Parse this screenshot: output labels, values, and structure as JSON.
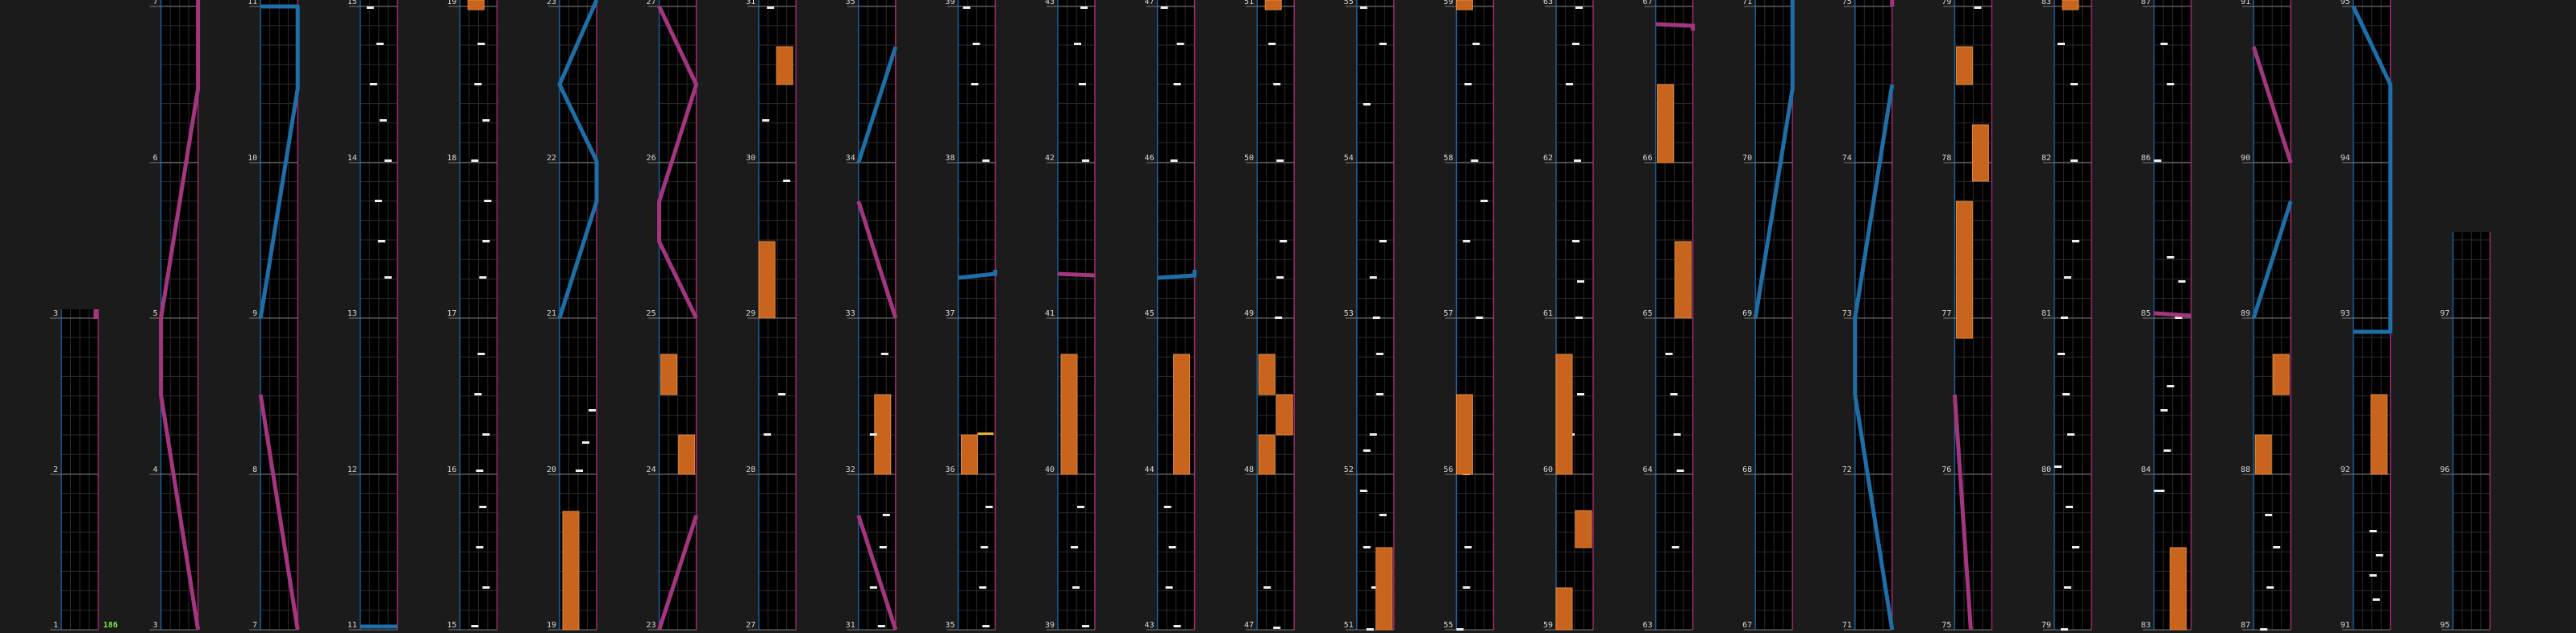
{
  "app": {
    "name": "chart-editor-timeline"
  },
  "colors": {
    "background": "#1b1b1b",
    "column": "#000000",
    "grid": "#2b2b2b",
    "measure_line": "#777777",
    "left_edge": "#1a5f99",
    "right_edge": "#a3296e",
    "left_slide": "#1e6fa8",
    "right_slide": "#a3367f",
    "hold": "#c9641e",
    "tap": "#eeeeee",
    "label": "#d8d8d8",
    "combo": "#7ee23c",
    "gold": "#e0b030"
  },
  "combo_count": "186",
  "columns": [
    {
      "labels": [
        "3",
        "2",
        "1"
      ]
    },
    {
      "labels": [
        "7",
        "6",
        "5",
        "4",
        "3"
      ]
    },
    {
      "labels": [
        "11",
        "10",
        "9",
        "8",
        "7"
      ]
    },
    {
      "labels": [
        "15",
        "14",
        "13",
        "12",
        "11"
      ]
    },
    {
      "labels": [
        "19",
        "18",
        "17",
        "16",
        "15"
      ]
    },
    {
      "labels": [
        "23",
        "22",
        "21",
        "20",
        "19"
      ]
    },
    {
      "labels": [
        "27",
        "26",
        "25",
        "24",
        "23"
      ]
    },
    {
      "labels": [
        "31",
        "30",
        "29",
        "28",
        "27"
      ]
    },
    {
      "labels": [
        "35",
        "34",
        "33",
        "32",
        "31"
      ]
    },
    {
      "labels": [
        "39",
        "38",
        "37",
        "36",
        "35"
      ]
    },
    {
      "labels": [
        "43",
        "42",
        "41",
        "40",
        "39"
      ]
    },
    {
      "labels": [
        "47",
        "46",
        "45",
        "44",
        "43"
      ]
    },
    {
      "labels": [
        "51",
        "50",
        "49",
        "48",
        "47"
      ]
    },
    {
      "labels": [
        "55",
        "54",
        "53",
        "52",
        "51"
      ]
    },
    {
      "labels": [
        "59",
        "58",
        "57",
        "56",
        "55"
      ]
    },
    {
      "labels": [
        "63",
        "62",
        "61",
        "60",
        "59"
      ]
    },
    {
      "labels": [
        "67",
        "66",
        "65",
        "64",
        "63"
      ]
    },
    {
      "labels": [
        "71",
        "70",
        "69",
        "68",
        "67"
      ]
    },
    {
      "labels": [
        "75",
        "74",
        "73",
        "72",
        "71"
      ]
    },
    {
      "labels": [
        "79",
        "78",
        "77",
        "76",
        "75"
      ]
    },
    {
      "labels": [
        "83",
        "82",
        "81",
        "80",
        "79"
      ]
    },
    {
      "labels": [
        "87",
        "86",
        "85",
        "84",
        "83"
      ]
    },
    {
      "labels": [
        "91",
        "90",
        "89",
        "88",
        "87"
      ]
    },
    {
      "labels": [
        "95",
        "94",
        "93",
        "92",
        "91"
      ]
    },
    {
      "labels": [
        "97",
        "96",
        "95"
      ]
    }
  ]
}
